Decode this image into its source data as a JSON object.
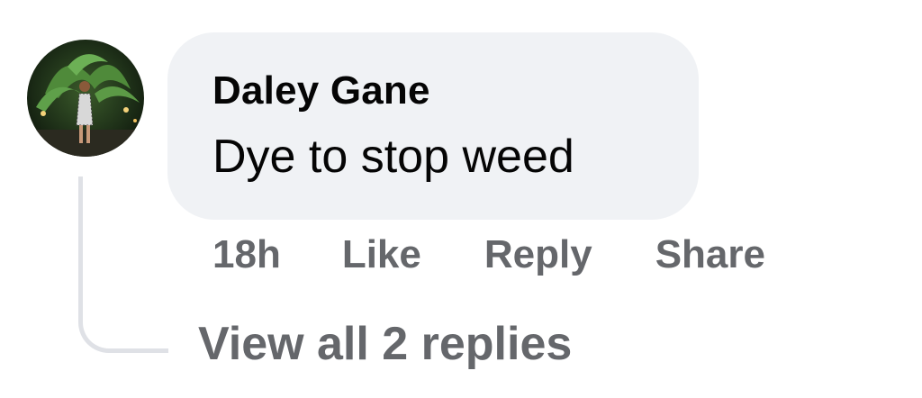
{
  "comment": {
    "avatar_icon": "user-avatar-photo",
    "author": "Daley Gane",
    "text": "Dye to stop weed",
    "timestamp": "18h",
    "like_label": "Like",
    "reply_label": "Reply",
    "share_label": "Share",
    "view_replies_label": "View all 2 replies"
  },
  "colors": {
    "bubble_bg": "#f0f2f5",
    "text": "#050505",
    "secondary_text": "#65676b",
    "thread_line": "#dfe1e6"
  }
}
